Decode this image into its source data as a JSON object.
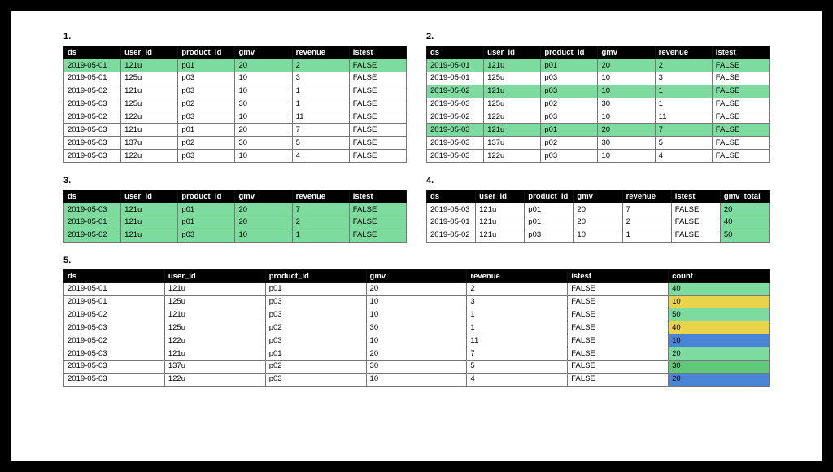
{
  "labels": {
    "t1": "1.",
    "t2": "2.",
    "t3": "3.",
    "t4": "4.",
    "t5": "5."
  },
  "headers6": [
    "ds",
    "user_id",
    "product_id",
    "gmv",
    "revenue",
    "istest"
  ],
  "headers7_gmv": [
    "ds",
    "user_id",
    "product_id",
    "gmv",
    "revenue",
    "istest",
    "gmv_total"
  ],
  "headers7_count": [
    "ds",
    "user_id",
    "product_id",
    "gmv",
    "revenue",
    "istest",
    "count"
  ],
  "table1": [
    {
      "hl": true,
      "c": [
        "2019-05-01",
        "121u",
        "p01",
        "20",
        "2",
        "FALSE"
      ]
    },
    {
      "hl": false,
      "c": [
        "2019-05-01",
        "125u",
        "p03",
        "10",
        "3",
        "FALSE"
      ]
    },
    {
      "hl": false,
      "c": [
        "2019-05-02",
        "121u",
        "p03",
        "10",
        "1",
        "FALSE"
      ]
    },
    {
      "hl": false,
      "c": [
        "2019-05-03",
        "125u",
        "p02",
        "30",
        "1",
        "FALSE"
      ]
    },
    {
      "hl": false,
      "c": [
        "2019-05-02",
        "122u",
        "p03",
        "10",
        "11",
        "FALSE"
      ]
    },
    {
      "hl": false,
      "c": [
        "2019-05-03",
        "121u",
        "p01",
        "20",
        "7",
        "FALSE"
      ]
    },
    {
      "hl": false,
      "c": [
        "2019-05-03",
        "137u",
        "p02",
        "30",
        "5",
        "FALSE"
      ]
    },
    {
      "hl": false,
      "c": [
        "2019-05-03",
        "122u",
        "p03",
        "10",
        "4",
        "FALSE"
      ]
    }
  ],
  "table2": [
    {
      "hl": true,
      "c": [
        "2019-05-01",
        "121u",
        "p01",
        "20",
        "2",
        "FALSE"
      ]
    },
    {
      "hl": false,
      "c": [
        "2019-05-01",
        "125u",
        "p03",
        "10",
        "3",
        "FALSE"
      ]
    },
    {
      "hl": true,
      "c": [
        "2019-05-02",
        "121u",
        "p03",
        "10",
        "1",
        "FALSE"
      ]
    },
    {
      "hl": false,
      "c": [
        "2019-05-03",
        "125u",
        "p02",
        "30",
        "1",
        "FALSE"
      ]
    },
    {
      "hl": false,
      "c": [
        "2019-05-02",
        "122u",
        "p03",
        "10",
        "11",
        "FALSE"
      ]
    },
    {
      "hl": true,
      "c": [
        "2019-05-03",
        "121u",
        "p01",
        "20",
        "7",
        "FALSE"
      ]
    },
    {
      "hl": false,
      "c": [
        "2019-05-03",
        "137u",
        "p02",
        "30",
        "5",
        "FALSE"
      ]
    },
    {
      "hl": false,
      "c": [
        "2019-05-03",
        "122u",
        "p03",
        "10",
        "4",
        "FALSE"
      ]
    }
  ],
  "table3": [
    {
      "hl": true,
      "c": [
        "2019-05-03",
        "121u",
        "p01",
        "20",
        "7",
        "FALSE"
      ]
    },
    {
      "hl": true,
      "c": [
        "2019-05-01",
        "121u",
        "p01",
        "20",
        "2",
        "FALSE"
      ]
    },
    {
      "hl": true,
      "c": [
        "2019-05-02",
        "121u",
        "p03",
        "10",
        "1",
        "FALSE"
      ]
    }
  ],
  "table4": [
    {
      "c": [
        "2019-05-03",
        "121u",
        "p01",
        "20",
        "7",
        "FALSE",
        "20"
      ],
      "last": "green"
    },
    {
      "c": [
        "2019-05-01",
        "121u",
        "p01",
        "20",
        "2",
        "FALSE",
        "40"
      ],
      "last": "green"
    },
    {
      "c": [
        "2019-05-02",
        "121u",
        "p03",
        "10",
        "1",
        "FALSE",
        "50"
      ],
      "last": "green"
    }
  ],
  "table5": [
    {
      "c": [
        "2019-05-01",
        "121u",
        "p01",
        "20",
        "2",
        "FALSE",
        "40"
      ],
      "last": "green"
    },
    {
      "c": [
        "2019-05-01",
        "125u",
        "p03",
        "10",
        "3",
        "FALSE",
        "10"
      ],
      "last": "yellow"
    },
    {
      "c": [
        "2019-05-02",
        "121u",
        "p03",
        "10",
        "1",
        "FALSE",
        "50"
      ],
      "last": "green"
    },
    {
      "c": [
        "2019-05-03",
        "125u",
        "p02",
        "30",
        "1",
        "FALSE",
        "40"
      ],
      "last": "yellow"
    },
    {
      "c": [
        "2019-05-02",
        "122u",
        "p03",
        "10",
        "11",
        "FALSE",
        "10"
      ],
      "last": "blue"
    },
    {
      "c": [
        "2019-05-03",
        "121u",
        "p01",
        "20",
        "7",
        "FALSE",
        "20"
      ],
      "last": "green"
    },
    {
      "c": [
        "2019-05-03",
        "137u",
        "p02",
        "30",
        "5",
        "FALSE",
        "30"
      ],
      "last": "green2"
    },
    {
      "c": [
        "2019-05-03",
        "122u",
        "p03",
        "10",
        "4",
        "FALSE",
        "20"
      ],
      "last": "blue"
    }
  ]
}
